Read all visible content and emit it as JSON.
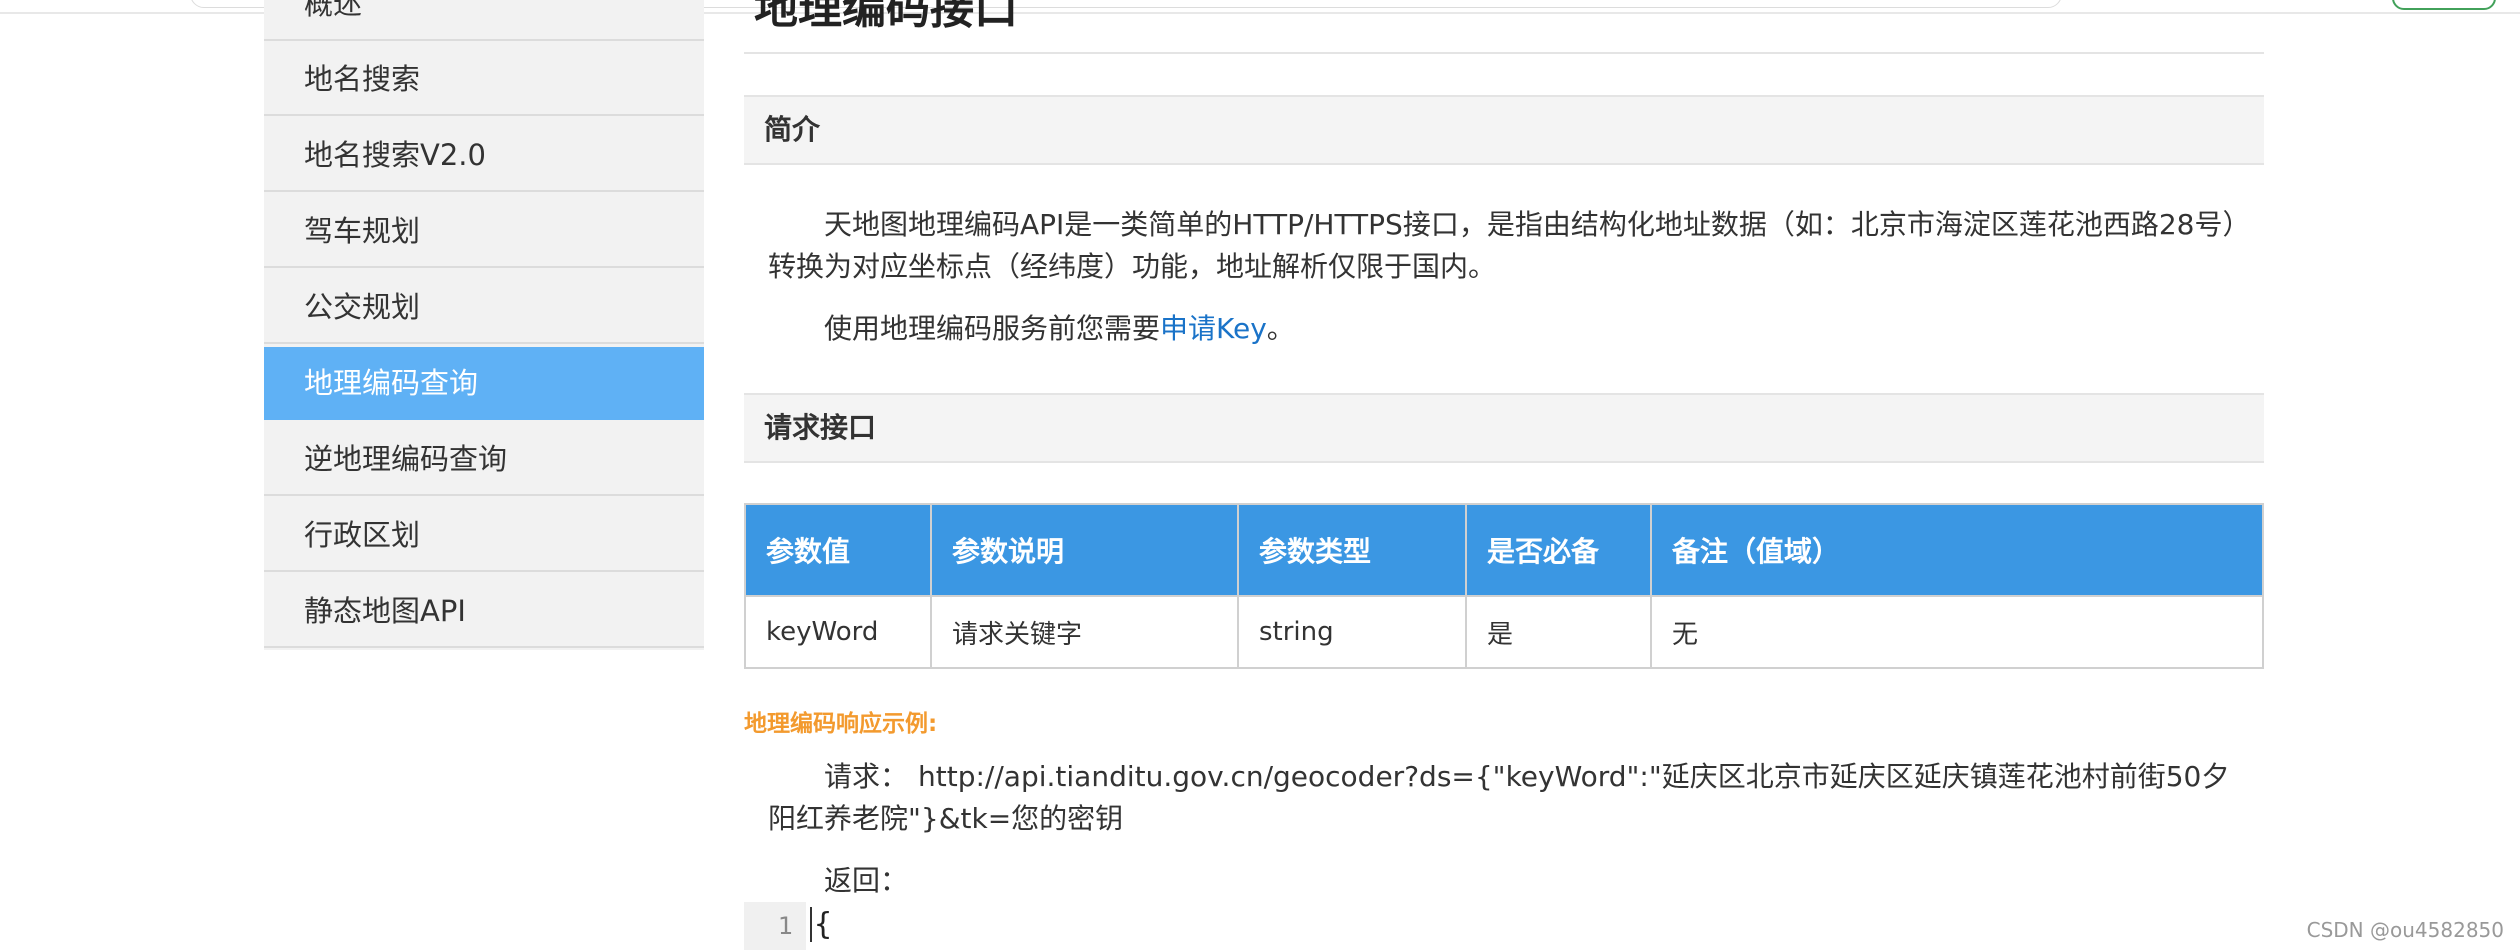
{
  "header": {
    "sidebar_cut_label": "概述",
    "page_title_cut": "地理编码接口"
  },
  "sidebar": {
    "items": [
      {
        "label": "地名搜索",
        "active": false
      },
      {
        "label": "地名搜索V2.0",
        "active": false
      },
      {
        "label": "驾车规划",
        "active": false
      },
      {
        "label": "公交规划",
        "active": false
      },
      {
        "label": "地理编码查询",
        "active": true
      },
      {
        "label": "逆地理编码查询",
        "active": false
      },
      {
        "label": "行政区划",
        "active": false
      },
      {
        "label": "静态地图API",
        "active": false
      }
    ]
  },
  "intro": {
    "heading": "简介",
    "para1": "天地图地理编码API是一类简单的HTTP/HTTPS接口，是指由结构化地址数据（如：北京市海淀区莲花池西路28号）转换为对应坐标点（经纬度）功能，地址解析仅限于国内。",
    "para2_prefix": "使用地理编码服务前您需要",
    "para2_link": "申请Key",
    "para2_suffix": "。"
  },
  "request": {
    "heading": "请求接口",
    "table": {
      "headers": [
        "参数值",
        "参数说明",
        "参数类型",
        "是否必备",
        "备注（值域）"
      ],
      "rows": [
        [
          "keyWord",
          "请求关键字",
          "string",
          "是",
          "无"
        ]
      ]
    }
  },
  "example": {
    "title": "地理编码响应示例:",
    "request_label": "请求：",
    "request_url": "http://api.tianditu.gov.cn/geocoder?ds={\"keyWord\":\"延庆区北京市延庆区延庆镇莲花池村前街50夕阳红养老院\"}&tk=您的密钥",
    "return_label": "返回：",
    "code_line_no": "1",
    "code_first": "{"
  },
  "watermark": "CSDN @ou4582850",
  "colors": {
    "active_sidebar": "#5fb1f5",
    "table_header": "#3b97e3",
    "link": "#1a73c8",
    "example_title": "#f39a2e"
  }
}
